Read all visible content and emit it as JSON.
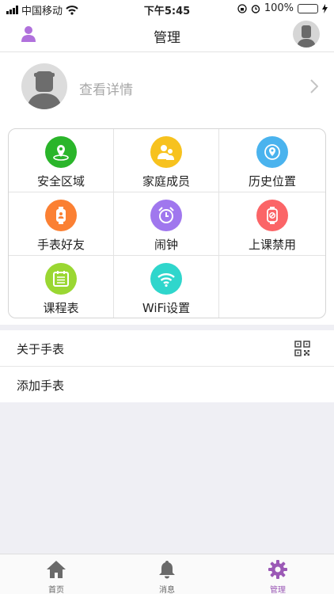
{
  "status_bar": {
    "carrier": "中国移动",
    "time": "下午5:45",
    "battery": "100%"
  },
  "header": {
    "title": "管理"
  },
  "profile": {
    "detail_label": "查看详情"
  },
  "features": [
    {
      "label": "安全区域",
      "icon": "location-pin-icon",
      "color": "#2ab52a"
    },
    {
      "label": "家庭成员",
      "icon": "family-members-icon",
      "color": "#f7c21e"
    },
    {
      "label": "历史位置",
      "icon": "history-location-icon",
      "color": "#4ab3ee"
    },
    {
      "label": "手表好友",
      "icon": "watch-friend-icon",
      "color": "#fb8033"
    },
    {
      "label": "闹钟",
      "icon": "alarm-clock-icon",
      "color": "#a077ee"
    },
    {
      "label": "上课禁用",
      "icon": "class-disable-icon",
      "color": "#fb6567"
    },
    {
      "label": "课程表",
      "icon": "schedule-icon",
      "color": "#9ad732"
    },
    {
      "label": "WiFi设置",
      "icon": "wifi-icon",
      "color": "#2fd6cc"
    }
  ],
  "menu": {
    "about_watch": "关于手表",
    "add_watch": "添加手表"
  },
  "tabbar": {
    "home": "首页",
    "messages": "消息",
    "manage": "管理"
  },
  "colors": {
    "accent": "#9b59b6"
  }
}
